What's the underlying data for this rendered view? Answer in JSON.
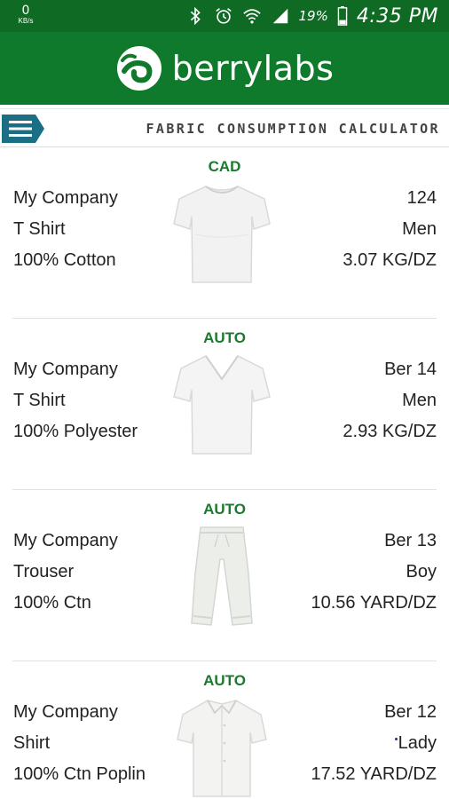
{
  "status_bar": {
    "speed_value": "0",
    "speed_unit": "KB/s",
    "battery_percent": "19%",
    "time": "4:35 PM",
    "icons": [
      "bluetooth-icon",
      "alarm-icon",
      "wifi-icon",
      "signal-icon",
      "battery-icon"
    ]
  },
  "app": {
    "brand": "berrylabs",
    "colors": {
      "status_bar": "#0f6a23",
      "app_bar": "#0f7a2b",
      "accent": "#1a7a2e",
      "menu": "#1a6f85"
    }
  },
  "toolbar": {
    "title": "FABRIC CONSUMPTION CALCULATOR",
    "menu_icon": "hamburger-menu-icon"
  },
  "items": [
    {
      "type": "CAD",
      "company": "My Company",
      "garment": "T Shirt",
      "fabric": "100% Cotton",
      "style": "124",
      "gender": "Men",
      "consumption": "3.07 KG/DZ",
      "image": "tshirt-crew-icon"
    },
    {
      "type": "AUTO",
      "company": "My Company",
      "garment": "T Shirt",
      "fabric": "100% Polyester",
      "style": "Ber 14",
      "gender": "Men",
      "consumption": "2.93 KG/DZ",
      "image": "tshirt-vneck-icon"
    },
    {
      "type": "AUTO",
      "company": "My Company",
      "garment": "Trouser",
      "fabric": "100% Ctn",
      "style": "Ber 13",
      "gender": "Boy",
      "consumption": "10.56 YARD/DZ",
      "image": "trouser-icon"
    },
    {
      "type": "AUTO",
      "company": "My Company",
      "garment": "Shirt",
      "fabric": "100% Ctn Poplin",
      "style": "Ber 12",
      "gender": "Lady",
      "consumption": "17.52 YARD/DZ",
      "image": "shirt-icon"
    }
  ]
}
